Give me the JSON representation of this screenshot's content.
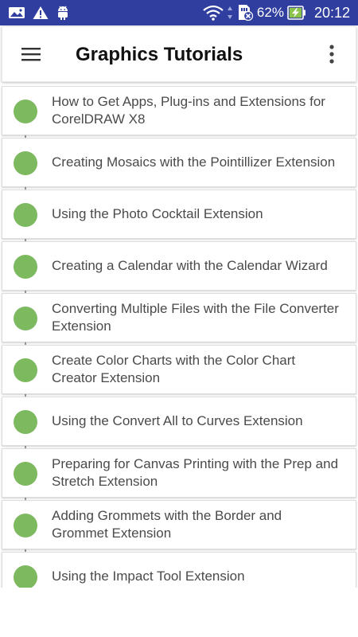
{
  "status_bar": {
    "battery_percent": "62%",
    "time": "20:12",
    "left_icons": [
      "image-icon",
      "warning-icon",
      "android-icon"
    ],
    "right_icons": [
      "wifi-icon",
      "sim-no-signal-icon",
      "battery-charging-icon"
    ],
    "background_color": "#303f9f"
  },
  "app_bar": {
    "title": "Graphics Tutorials",
    "menu_icon": "hamburger-menu-icon",
    "overflow_icon": "more-vert-icon"
  },
  "accent_color": "#7cb95f",
  "tutorials": [
    "How to Get Apps, Plug-ins and Extensions for CorelDRAW X8",
    "Creating Mosaics with the Pointillizer Extension",
    "Using the Photo Cocktail Extension",
    "Creating a Calendar with the Calendar Wizard",
    "Converting Multiple Files with the File Converter Extension",
    "Create Color Charts with the Color Chart Creator Extension",
    "Using the Convert All to Curves Extension",
    "Preparing for Canvas Printing with the Prep and Stretch Extension",
    "Adding Grommets with the Border and Grommet Extension",
    "Using the Impact Tool Extension"
  ]
}
